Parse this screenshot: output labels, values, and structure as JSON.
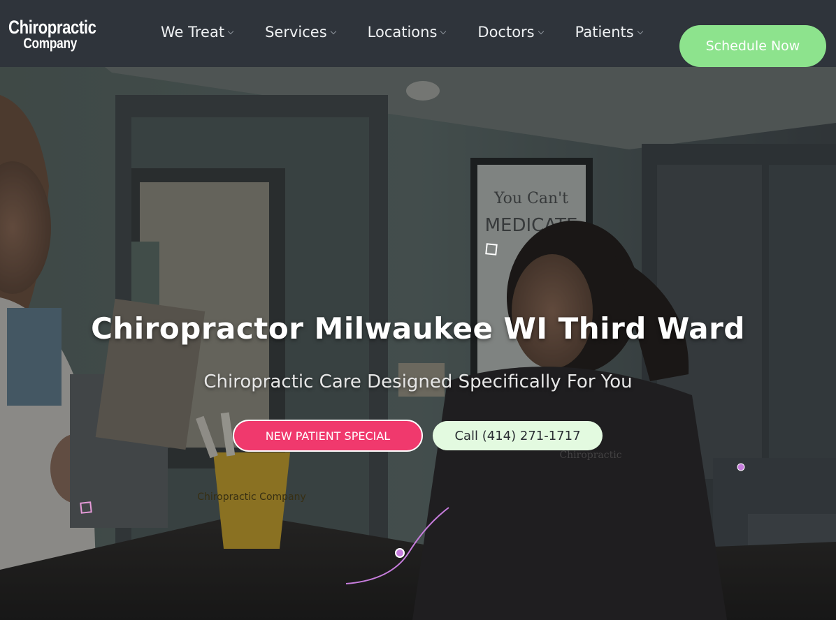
{
  "header": {
    "logo_line1": "Chiropractic",
    "logo_line2": "Company",
    "nav": [
      {
        "label": "We Treat"
      },
      {
        "label": "Services"
      },
      {
        "label": "Locations"
      },
      {
        "label": "Doctors"
      },
      {
        "label": "Patients"
      }
    ],
    "schedule_label": "Schedule Now"
  },
  "hero": {
    "title": "Chiropractor Milwaukee WI Third Ward",
    "subtitle": "Chiropractic Care Designed Specifically For You",
    "primary_cta": "NEW PATIENT SPECIAL",
    "secondary_cta": "Call (414) 271-1717",
    "poster_text": [
      "You Can't",
      "MEDICATE"
    ],
    "cup_text": "Chiropractic Company"
  },
  "colors": {
    "nav_bg": "#2f343b",
    "accent_green": "#8de38d",
    "accent_pink": "#f0396d",
    "call_bg": "#e3fae0",
    "deco_purple": "#c77ddd"
  }
}
